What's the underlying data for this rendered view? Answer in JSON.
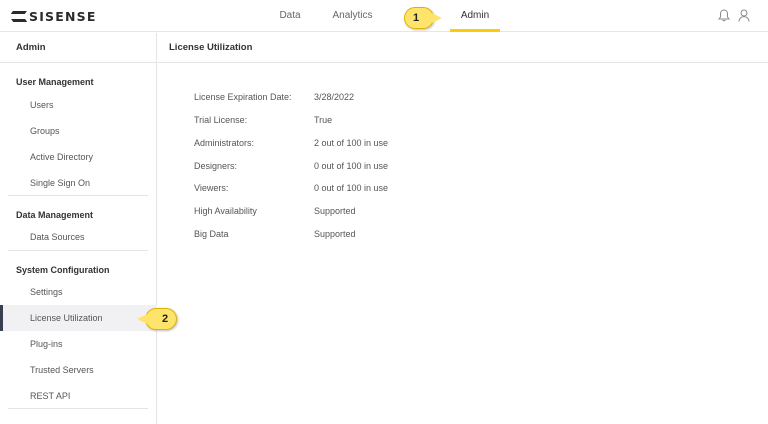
{
  "brand": {
    "logo_text": "SISENSE"
  },
  "nav": {
    "data": "Data",
    "analytics": "Analytics",
    "admin": "Admin",
    "active": "admin",
    "accent_color": "#ffcb05"
  },
  "callouts": {
    "one": "1",
    "two": "2",
    "color": "#ffe46b"
  },
  "icons": {
    "bell": "bell-icon",
    "user": "user-icon"
  },
  "sidebar": {
    "header": "Admin",
    "sections": [
      {
        "title": "User Management",
        "items": [
          "Users",
          "Groups",
          "Active Directory",
          "Single Sign On"
        ]
      },
      {
        "title": "Data Management",
        "items": [
          "Data Sources"
        ]
      },
      {
        "title": "System Configuration",
        "items": [
          "Settings",
          "License Utilization",
          "Plug-ins",
          "Trusted Servers",
          "REST API"
        ]
      }
    ],
    "active_item": "License Utilization"
  },
  "main": {
    "title": "License Utilization",
    "rows": [
      {
        "label": "License Expiration Date:",
        "value": "3/28/2022"
      },
      {
        "label": "Trial License:",
        "value": "True"
      },
      {
        "label": "Administrators:",
        "value": "2 out of 100 in use"
      },
      {
        "label": "Designers:",
        "value": "0 out of 100 in use"
      },
      {
        "label": "Viewers:",
        "value": "0 out of 100 in use"
      },
      {
        "label": "High Availability",
        "value": "Supported"
      },
      {
        "label": "Big Data",
        "value": "Supported"
      }
    ]
  }
}
